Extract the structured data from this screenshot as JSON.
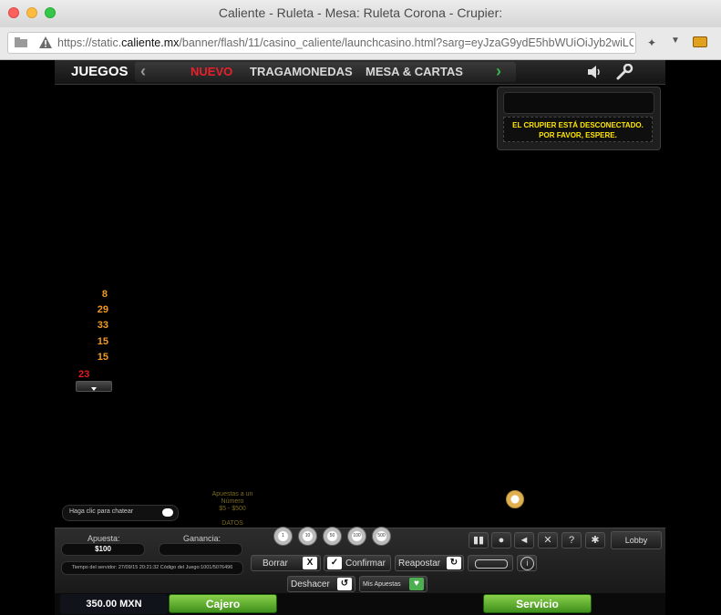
{
  "window": {
    "title": "Caliente - Ruleta - Mesa: Ruleta Corona - Crupier:",
    "url_prefix": "https://static.",
    "url_domain": "caliente.mx",
    "url_rest": "/banner/flash/11/casino_caliente/launchcasino.html?sarg=eyJzaG9ydE5hbWUiOiJyb2wiLC"
  },
  "nav": {
    "juegos": "JUEGOS",
    "items": [
      "NUEVO",
      "TRAGAMONEDAS",
      "MESA & CARTAS"
    ],
    "active_color": "#e8202a"
  },
  "dealer": {
    "message_line1": "EL CRUPIER ESTÁ DESCONECTADO.",
    "message_line2": "POR FAVOR, ESPERE."
  },
  "history": {
    "numbers": [
      "8",
      "29",
      "33",
      "15",
      "15"
    ],
    "last": "23"
  },
  "chat": {
    "placeholder": "Haga clic para chatear"
  },
  "apuestas": {
    "line1": "Apuestas a un",
    "line2": "Número",
    "line3": "$5 - $500",
    "line4": "DATOS"
  },
  "panel": {
    "apuesta_label": "Apuesta:",
    "apuesta_value": "$100",
    "ganancia_label": "Ganancia:",
    "ganancia_value": "",
    "server_time": "Tiempo del servidor: 27/09/15 20:21:32 Código del Juego:1001/5076496",
    "chips": [
      "1",
      "10",
      "50",
      "100",
      "500"
    ],
    "borrar": "Borrar",
    "confirmar": "Confirmar",
    "reapostar": "Reapostar",
    "deshacer": "Deshacer",
    "mis_apuestas": "Mis Apuestas",
    "lobby": "Lobby"
  },
  "bottom": {
    "balance": "350.00 MXN",
    "cajero": "Cajero",
    "servicio": "Servicio"
  }
}
